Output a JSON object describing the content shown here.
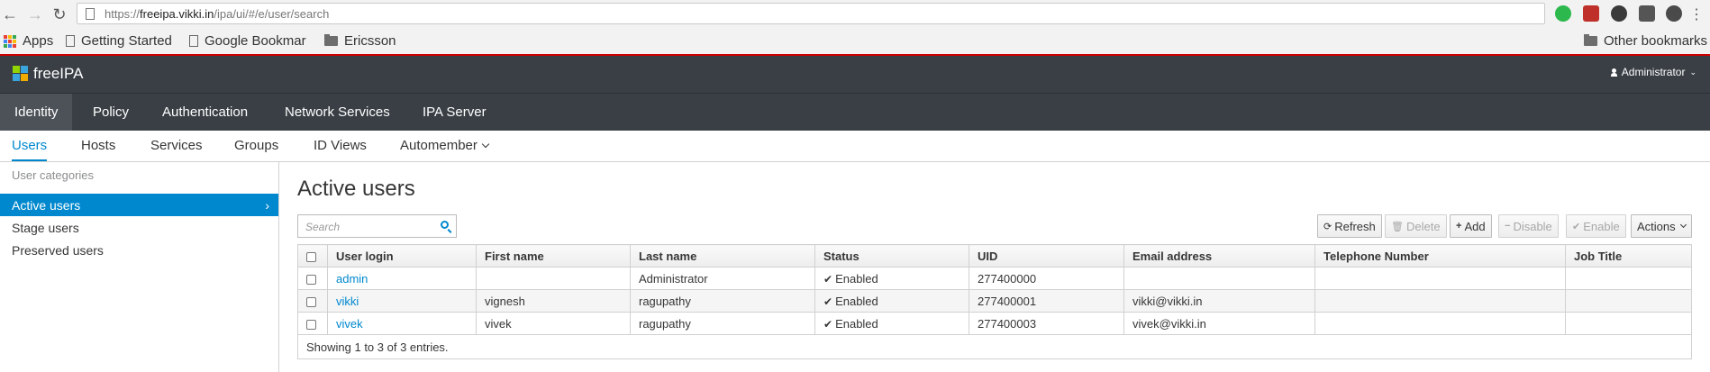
{
  "browser": {
    "url_prefix": "https://",
    "url_host": "freeipa.vikki.in",
    "url_path": "/ipa/ui/#/e/user/search",
    "bookmarks": [
      {
        "label": "Apps",
        "icon": "apps-grid-icon"
      },
      {
        "label": "Getting Started",
        "icon": "page-icon"
      },
      {
        "label": "Google Bookmar",
        "icon": "page-icon"
      },
      {
        "label": "Ericsson",
        "icon": "folder-icon"
      }
    ],
    "other_bookmarks": "Other bookmarks"
  },
  "header": {
    "brand": "freeIPA",
    "user_menu": "Administrator"
  },
  "primary_nav": [
    {
      "label": "Identity",
      "active": true
    },
    {
      "label": "Policy"
    },
    {
      "label": "Authentication"
    },
    {
      "label": "Network Services"
    },
    {
      "label": "IPA Server"
    }
  ],
  "secondary_nav": [
    {
      "label": "Users",
      "active": true
    },
    {
      "label": "Hosts"
    },
    {
      "label": "Services"
    },
    {
      "label": "Groups"
    },
    {
      "label": "ID Views"
    },
    {
      "label": "Automember"
    }
  ],
  "sidebar": {
    "heading": "User categories",
    "items": [
      {
        "label": "Active users",
        "active": true
      },
      {
        "label": "Stage users"
      },
      {
        "label": "Preserved users"
      }
    ]
  },
  "main": {
    "title": "Active users",
    "search_placeholder": "Search",
    "buttons": {
      "refresh": "Refresh",
      "delete": "Delete",
      "add": "Add",
      "disable": "Disable",
      "enable": "Enable",
      "actions": "Actions"
    },
    "columns": [
      "User login",
      "First name",
      "Last name",
      "Status",
      "UID",
      "Email address",
      "Telephone Number",
      "Job Title"
    ],
    "rows": [
      {
        "login": "admin",
        "first": "",
        "last": "Administrator",
        "status": "Enabled",
        "uid": "277400000",
        "email": "",
        "phone": "",
        "job": ""
      },
      {
        "login": "vikki",
        "first": "vignesh",
        "last": "ragupathy",
        "status": "Enabled",
        "uid": "277400001",
        "email": "vikki@vikki.in",
        "phone": "",
        "job": ""
      },
      {
        "login": "vivek",
        "first": "vivek",
        "last": "ragupathy",
        "status": "Enabled",
        "uid": "277400003",
        "email": "vivek@vikki.in",
        "phone": "",
        "job": ""
      }
    ],
    "footer": "Showing 1 to 3 of 3 entries."
  }
}
